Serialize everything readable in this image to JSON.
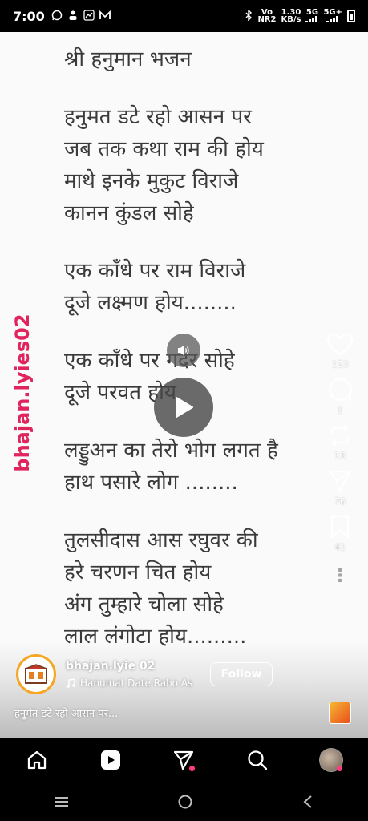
{
  "status_bar": {
    "time": "7:00",
    "left_icons": [
      "whatsapp-icon",
      "person-icon",
      "gallery-icon",
      "m-icon"
    ],
    "network_vo": "Vo",
    "network_nr": "NR2",
    "speed_value": "1.30",
    "speed_unit": "KB/s",
    "signal_5g": "5G",
    "signal_5g_plus": "5G+"
  },
  "reel": {
    "lyrics": [
      "श्री हनुमान भजन",
      "",
      "हनुमत डटे रहो आसन पर",
      "जब तक कथा राम की होय",
      "माथे इनके मुकुट विराजे",
      "कानन कुंडल सोहे",
      "",
      "एक काँधे पर राम विराजे",
      "दूजे लक्ष्मण होय........",
      "",
      "एक काँधे पर गदर सोहे",
      "दूजे परवत होय",
      "",
      "लड्डुअन का तेरो भोग लगत है",
      "हाथ पसारे लोग ........",
      "",
      "तुलसीदास आस रघुवर की",
      "हरे चरणन चित होय",
      "अंग तुम्हारे चोला सोहे",
      "लाल लंगोटा होय........."
    ],
    "watermark": "bhajan.lyies02",
    "like_count": "153",
    "comment_count": "1",
    "repost_count": "13",
    "share_count": "76",
    "save_count": "41",
    "author_name": "bhajan.lyie 02",
    "audio_title": "Hanumat Date Raho As",
    "follow_label": "Follow",
    "caption": "हनुमंत डटे रहो आसन पर..."
  },
  "colors": {
    "watermark": "#e0245e",
    "lyrics_text": "#3a3a3a",
    "background": "#fafafa",
    "accent_pink": "#ff3b7f"
  }
}
